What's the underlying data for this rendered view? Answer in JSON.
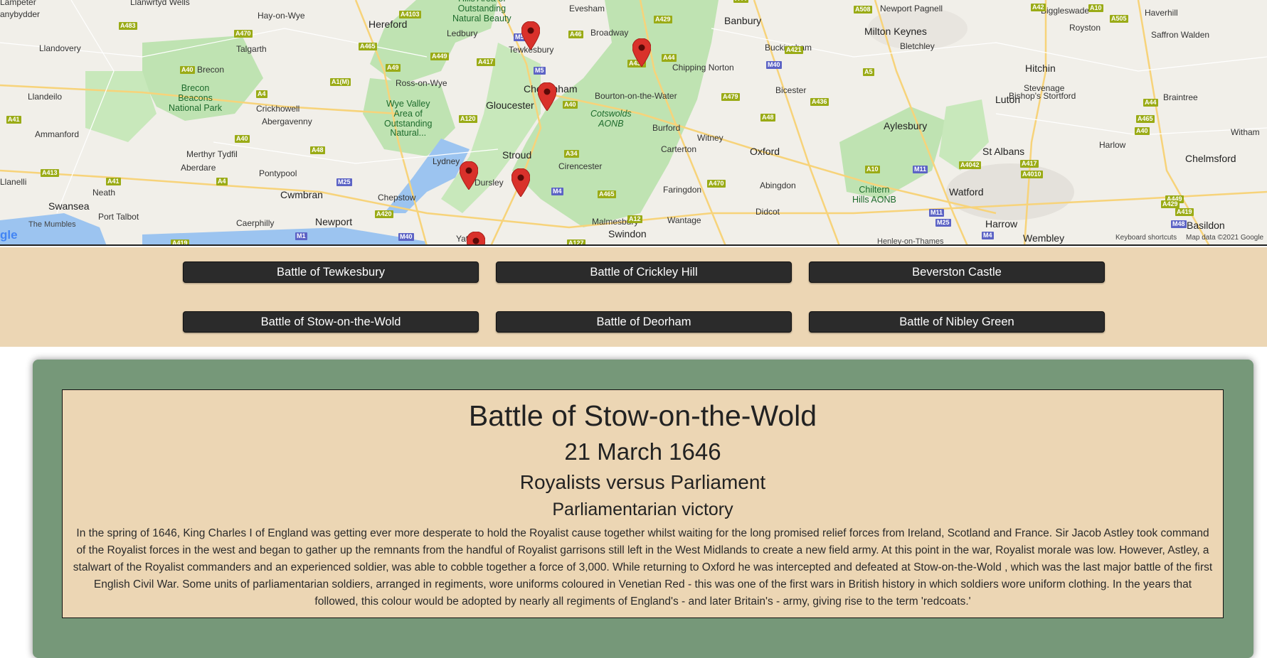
{
  "map": {
    "places": [
      {
        "text": "Lampeter",
        "cls": "town"
      },
      {
        "text": "Llanwrtyd Wells",
        "cls": "town"
      },
      {
        "text": "Hay-on-Wye",
        "cls": "town"
      },
      {
        "text": "Hereford",
        "cls": "city"
      },
      {
        "text": "Ledbury",
        "cls": "town"
      },
      {
        "text": "Evesham",
        "cls": "town"
      },
      {
        "text": "Broadway",
        "cls": "town"
      },
      {
        "text": "Banbury",
        "cls": "city"
      },
      {
        "text": "Newport Pagnell",
        "cls": "town"
      },
      {
        "text": "Milton Keynes",
        "cls": "city"
      },
      {
        "text": "Bletchley",
        "cls": "town"
      },
      {
        "text": "Biggleswade",
        "cls": "town"
      },
      {
        "text": "Royston",
        "cls": "town"
      },
      {
        "text": "Haverhill",
        "cls": "town"
      },
      {
        "text": "Saffron Walden",
        "cls": "town"
      },
      {
        "text": "Llandovery",
        "cls": "town"
      },
      {
        "text": "Talgarth",
        "cls": "town"
      },
      {
        "text": "Tewkesbury",
        "cls": "town"
      },
      {
        "text": "Chipping Norton",
        "cls": "town"
      },
      {
        "text": "Buckingham",
        "cls": "town"
      },
      {
        "text": "Hitchin",
        "cls": "city"
      },
      {
        "text": "Stevenage",
        "cls": "town"
      },
      {
        "text": "Bishop's Stortford",
        "cls": "town"
      },
      {
        "text": "Braintree",
        "cls": "town"
      },
      {
        "text": "Llandeilo",
        "cls": "town"
      },
      {
        "text": "Brecon",
        "cls": "town"
      },
      {
        "text": "Ross-on-Wye",
        "cls": "town"
      },
      {
        "text": "Cheltenham",
        "cls": "city"
      },
      {
        "text": "Gloucester",
        "cls": "city"
      },
      {
        "text": "Bourton-on-the-Water",
        "cls": "town"
      },
      {
        "text": "Bicester",
        "cls": "town"
      },
      {
        "text": "Luton",
        "cls": "city"
      },
      {
        "text": "Crickhowell",
        "cls": "town"
      },
      {
        "text": "Abergavenny",
        "cls": "town"
      },
      {
        "text": "Aylesbury",
        "cls": "city"
      },
      {
        "text": "Burford",
        "cls": "town"
      },
      {
        "text": "Witney",
        "cls": "town"
      },
      {
        "text": "Ammanford",
        "cls": "town"
      },
      {
        "text": "Merthyr Tydfil",
        "cls": "town"
      },
      {
        "text": "Stroud",
        "cls": "city"
      },
      {
        "text": "Carterton",
        "cls": "town"
      },
      {
        "text": "Oxford",
        "cls": "city"
      },
      {
        "text": "St Albans",
        "cls": "city"
      },
      {
        "text": "Harlow",
        "cls": "town"
      },
      {
        "text": "Chelmsford",
        "cls": "city"
      },
      {
        "text": "Aberdare",
        "cls": "town"
      },
      {
        "text": "Lydney",
        "cls": "town"
      },
      {
        "text": "Cirencester",
        "cls": "town"
      },
      {
        "text": "Pontypool",
        "cls": "town"
      },
      {
        "text": "Llanelli",
        "cls": "town"
      },
      {
        "text": "Dursley",
        "cls": "town"
      },
      {
        "text": "Abingdon",
        "cls": "town"
      },
      {
        "text": "Neath",
        "cls": "town"
      },
      {
        "text": "Cwmbran",
        "cls": "city"
      },
      {
        "text": "Faringdon",
        "cls": "town"
      },
      {
        "text": "Watford",
        "cls": "city"
      },
      {
        "text": "Chepstow",
        "cls": "town"
      },
      {
        "text": "Swansea",
        "cls": "city"
      },
      {
        "text": "Port Talbot",
        "cls": "town"
      },
      {
        "text": "Malmesbury",
        "cls": "town"
      },
      {
        "text": "Didcot",
        "cls": "town"
      },
      {
        "text": "Wantage",
        "cls": "town"
      },
      {
        "text": "The Mumbles",
        "cls": "small"
      },
      {
        "text": "Caerphilly",
        "cls": "town"
      },
      {
        "text": "Newport",
        "cls": "city"
      },
      {
        "text": "Harrow",
        "cls": "city"
      },
      {
        "text": "Basildon",
        "cls": "city"
      },
      {
        "text": "Swindon",
        "cls": "city"
      },
      {
        "text": "Wembley",
        "cls": "city"
      },
      {
        "text": "Yate",
        "cls": "town"
      },
      {
        "text": "Henley-on-Thames",
        "cls": "small"
      },
      {
        "text": "Witham",
        "cls": "town"
      },
      {
        "text": "anybydder",
        "cls": "town"
      }
    ],
    "green_labels": [
      {
        "text": "Hills Area of Outstanding Natural Beauty",
        "lines": [
          "Hills Area of",
          "Outstanding",
          "Natural Beauty"
        ]
      },
      {
        "text": "Brecon Beacons National Park",
        "lines": [
          "Brecon",
          "Beacons",
          "National Park"
        ]
      },
      {
        "text": "Wye Valley Area of Outstanding Natural...",
        "lines": [
          "Wye Valley",
          "Area of",
          "Outstanding",
          "Natural..."
        ]
      },
      {
        "text": "Cotswolds AONB",
        "lines": [
          "Cotswolds",
          "AONB"
        ]
      },
      {
        "text": "Chiltern Hills AONB",
        "lines": [
          "Chiltern",
          "Hills AONB"
        ]
      }
    ],
    "roads": [
      "A483",
      "A470",
      "A4103",
      "A44",
      "A46",
      "A429",
      "A508",
      "A10",
      "A505",
      "M50",
      "A465",
      "A449",
      "A417",
      "A44",
      "A421",
      "M40",
      "A5",
      "A40",
      "A49",
      "M5",
      "A438",
      "A42",
      "A1(M)",
      "A4",
      "A40",
      "A479",
      "A436",
      "A44",
      "A41",
      "A120",
      "A48",
      "A40",
      "A465",
      "A40",
      "A48",
      "A34",
      "A10",
      "M11",
      "A4042",
      "A417",
      "A4010",
      "A413",
      "A41",
      "A4",
      "M25",
      "M4",
      "A465",
      "A470",
      "A449",
      "A429",
      "A419",
      "A420",
      "A12",
      "M11",
      "M25",
      "M48",
      "A419",
      "M1",
      "M40",
      "A127",
      "M4",
      "M4",
      "M49",
      "M4",
      "A40"
    ],
    "credit_shortcuts": "Keyboard shortcuts",
    "credit_data": "Map data ©2021 Google",
    "logo": "gle",
    "marker_color": "#d9312b"
  },
  "buttons": [
    {
      "label": "Battle of Tewkesbury"
    },
    {
      "label": "Battle of Crickley Hill"
    },
    {
      "label": "Beverston Castle"
    },
    {
      "label": "Battle of Stow-on-the-Wold"
    },
    {
      "label": "Battle of Deorham"
    },
    {
      "label": "Battle of Nibley Green"
    }
  ],
  "info": {
    "title": "Battle of Stow-on-the-Wold",
    "date": "21 March 1646",
    "sides": "Royalists versus Parliament",
    "result": "Parliamentarian victory",
    "description": "In the spring of 1646, King Charles I of England was getting ever more desperate to hold the Royalist cause together whilst waiting for the long promised relief forces from Ireland, Scotland and France. Sir Jacob Astley took command of the Royalist forces in the west and began to gather up the remnants from the handful of Royalist garrisons still left in the West Midlands to create a new field army. At this point in the war, Royalist morale was low. However, Astley, a stalwart of the Royalist commanders and an experienced soldier, was able to cobble together a force of 3,000. While returning to Oxford he was intercepted and defeated at Stow-on-the-Wold , which was the last major battle of the first English Civil War. Some units of parliamentarian soldiers, arranged in regiments, wore uniforms coloured in Venetian Red - this was one of the first wars in British history in which soldiers wore uniform clothing. In the years that followed, this colour would be adopted by nearly all regiments of England's - and later Britain's - army, giving rise to the term 'redcoats.'"
  },
  "colors": {
    "button_area_bg": "#ecd6b4",
    "panel_bg": "#769879",
    "card_bg": "#ecd6b4",
    "button_bg": "#2b2b2b"
  }
}
